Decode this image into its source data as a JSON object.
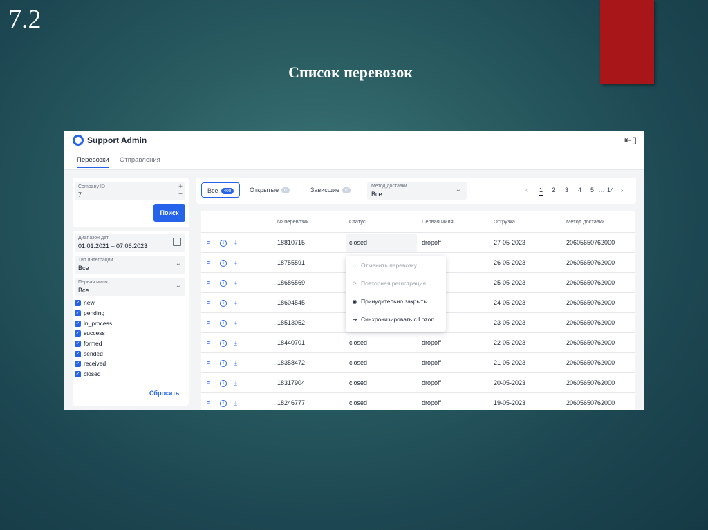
{
  "slide": {
    "number": "7.2",
    "title": "Список перевозок"
  },
  "app": {
    "title": "Support Admin",
    "tabs": [
      "Перевозки",
      "Отправления"
    ]
  },
  "filters": {
    "company_id": {
      "label": "Company ID",
      "value": "7"
    },
    "search_button": "Поиск",
    "date_range": {
      "label": "Диапазон дат",
      "value": "01.01.2021 – 07.06.2023"
    },
    "integration_type": {
      "label": "Тип интеграции",
      "value": "Все"
    },
    "first_mile": {
      "label": "Первая миля",
      "value": "Все"
    },
    "statuses": [
      "new",
      "pending",
      "in_process",
      "success",
      "formed",
      "sended",
      "received",
      "closed"
    ],
    "reset_button": "Сбросить"
  },
  "toolbar": {
    "segments": [
      {
        "label": "Все",
        "count": "408"
      },
      {
        "label": "Открытые",
        "count": "0"
      },
      {
        "label": "Зависшие",
        "count": "0"
      }
    ],
    "delivery_method": {
      "label": "Метод доставки",
      "value": "Все"
    },
    "pagination": {
      "prev": "‹",
      "pages": [
        "1",
        "2",
        "3",
        "4",
        "5"
      ],
      "ellipsis": "...",
      "last": "14",
      "next": "›",
      "current": "1"
    }
  },
  "table": {
    "columns": [
      "№ перевозки",
      "Статус",
      "Первая миля",
      "Отгрузка",
      "Метод доставки"
    ],
    "rows": [
      {
        "id": "18810715",
        "status": "closed",
        "first_mile": "dropoff",
        "shipment": "27-05-2023",
        "method": "20605650762000"
      },
      {
        "id": "18755591",
        "status": "",
        "first_mile": "",
        "shipment": "26-05-2023",
        "method": "20605650762000"
      },
      {
        "id": "18686569",
        "status": "",
        "first_mile": "",
        "shipment": "25-05-2023",
        "method": "20605650762000"
      },
      {
        "id": "18604545",
        "status": "",
        "first_mile": "",
        "shipment": "24-05-2023",
        "method": "20605650762000"
      },
      {
        "id": "18513052",
        "status": "",
        "first_mile": "",
        "shipment": "23-05-2023",
        "method": "20605650762000"
      },
      {
        "id": "18440701",
        "status": "closed",
        "first_mile": "dropoff",
        "shipment": "22-05-2023",
        "method": "20605650762000"
      },
      {
        "id": "18358472",
        "status": "closed",
        "first_mile": "dropoff",
        "shipment": "21-05-2023",
        "method": "20605650762000"
      },
      {
        "id": "18317904",
        "status": "closed",
        "first_mile": "dropoff",
        "shipment": "20-05-2023",
        "method": "20605650762000"
      },
      {
        "id": "18246777",
        "status": "closed",
        "first_mile": "dropoff",
        "shipment": "19-05-2023",
        "method": "20605650762000"
      }
    ]
  },
  "context_menu": {
    "items": [
      {
        "label": "Отменить перевозку",
        "enabled": false,
        "icon": "cancel-icon"
      },
      {
        "label": "Повторная регистрация",
        "enabled": false,
        "icon": "refresh-icon"
      },
      {
        "label": "Принудительно закрыть",
        "enabled": true,
        "icon": "stop-icon"
      },
      {
        "label": "Синхронизировать с Lozon",
        "enabled": true,
        "icon": "sync-icon"
      }
    ]
  },
  "colors": {
    "accent": "#2563eb",
    "slide_red": "#a8161a",
    "background": "#1f4e57"
  }
}
